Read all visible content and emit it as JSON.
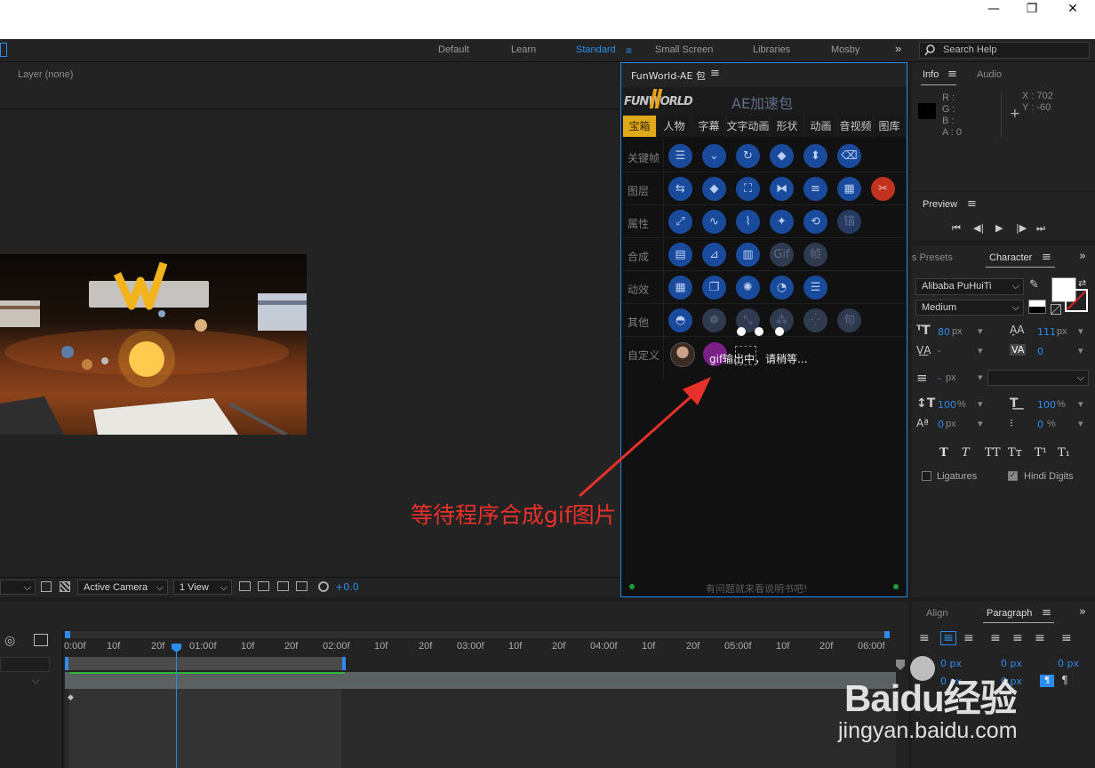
{
  "window": {
    "minimize": "—",
    "maximize": "❐",
    "close": "✕"
  },
  "workspaces": {
    "items": [
      "Default",
      "Learn",
      "Standard",
      "Small Screen",
      "Libraries",
      "Mosby"
    ],
    "active": "Standard",
    "more": "»"
  },
  "search": {
    "placeholder": "Search Help"
  },
  "viewer": {
    "layer_label": "Layer (none)",
    "camera": "Active Camera",
    "view": "1 View",
    "exposure": "+0.0"
  },
  "plugin": {
    "tab_title": "FunWorld-AE 包",
    "logo_text": "FUNWORLD",
    "header": "AE加速包",
    "tabs": [
      "宝箱",
      "人物",
      "字幕",
      "文字动画",
      "形状",
      "动画",
      "音视频",
      "图库"
    ],
    "active_tab": "宝箱",
    "rows": [
      {
        "label": "关键帧"
      },
      {
        "label": "图层"
      },
      {
        "label": "属性"
      },
      {
        "label": "合成"
      },
      {
        "label": "动效"
      },
      {
        "label": "其他"
      },
      {
        "label": "自定义"
      }
    ],
    "icon_labels": {
      "gif": "Gif",
      "frame": "帧",
      "anchor": "锚",
      "sentence": "句"
    },
    "status": "gif输出中，请稍等...",
    "footer": "有问题就来看说明书吧!"
  },
  "annotation": {
    "text": "等待程序合成gif图片",
    "color": "#e8312a"
  },
  "info": {
    "tabs": [
      "Info",
      "Audio"
    ],
    "r": "R :",
    "g": "G :",
    "b": "B :",
    "a": "A : 0",
    "x": "X : 702",
    "y": "Y : -60"
  },
  "preview": {
    "title": "Preview"
  },
  "character": {
    "tabs": [
      "s Presets",
      "Character"
    ],
    "font": "Alibaba PuHuiTi",
    "style": "Medium",
    "size": "80",
    "size_unit": "px",
    "leading": "111",
    "leading_unit": "px",
    "kerning": "-",
    "tracking": "0",
    "stroke": "-",
    "stroke_unit": "px",
    "vscale": "100",
    "vscale_unit": "%",
    "hscale": "100",
    "hscale_unit": "%",
    "baseline": "0",
    "baseline_unit": "px",
    "tsume": "0",
    "tsume_unit": "%",
    "styles": [
      "T",
      "T",
      "TT",
      "Tт",
      "T¹",
      "T₁"
    ],
    "ligatures": "Ligatures",
    "hindi": "Hindi Digits"
  },
  "paragraph": {
    "tabs": [
      "Align",
      "Paragraph"
    ],
    "indent_values": [
      "0 px",
      "0 px",
      "0 px",
      "0 px",
      "0 px"
    ]
  },
  "timeline": {
    "ticks": [
      "0:00f",
      "10f",
      "20f",
      "01:00f",
      "10f",
      "20f",
      "02:00f",
      "10f",
      "20f",
      "03:00f",
      "10f",
      "20f",
      "04:00f",
      "10f",
      "20f",
      "05:00f",
      "10f",
      "20f",
      "06:00f"
    ]
  },
  "watermark": {
    "brand": "Baidu经验",
    "url": "jingyan.baidu.com"
  },
  "colors": {
    "accent": "#2d8ceb",
    "panel_bg": "#232323",
    "plugin_icon": "#1a4a9c"
  }
}
